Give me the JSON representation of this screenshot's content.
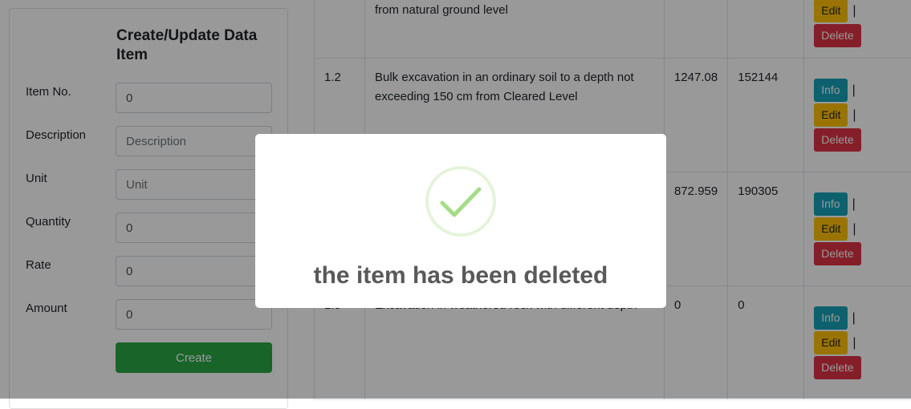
{
  "form": {
    "title": "Create/Update Data Item",
    "fields": [
      {
        "label": "Item No.",
        "value": "0",
        "placeholder": ""
      },
      {
        "label": "Description",
        "value": "",
        "placeholder": "Description"
      },
      {
        "label": "Unit",
        "value": "",
        "placeholder": "Unit"
      },
      {
        "label": "Quantity",
        "value": "0",
        "placeholder": ""
      },
      {
        "label": "Rate",
        "value": "0",
        "placeholder": ""
      },
      {
        "label": "Amount",
        "value": "0",
        "placeholder": ""
      }
    ],
    "create_label": "Create"
  },
  "table": {
    "rows": [
      {
        "no": "",
        "description": "from natural ground level",
        "quantity": "",
        "amount": ""
      },
      {
        "no": "1.2",
        "description": "Bulk excavation in an ordinary soil to a depth not exceeding 150 cm from Cleared Level",
        "quantity": "1247.08",
        "amount": "152144"
      },
      {
        "no": "",
        "description": "",
        "quantity": "872.959",
        "amount": "190305"
      },
      {
        "no": "1.5",
        "description": "Excavation in weathered rock with different depth",
        "quantity": "0",
        "amount": "0"
      }
    ],
    "actions": {
      "info": "Info",
      "edit": "Edit",
      "delete": "Delete",
      "separator": "|"
    }
  },
  "modal": {
    "message": "the item has been deleted",
    "icon": "success-check-icon",
    "icon_color": "#a5dc86"
  }
}
